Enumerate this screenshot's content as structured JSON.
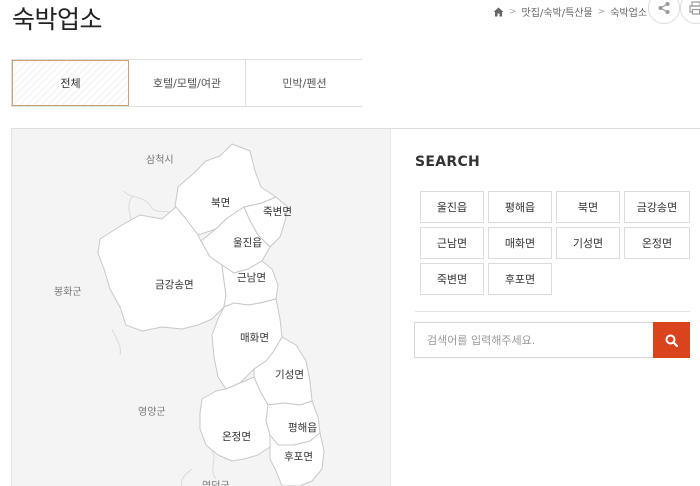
{
  "page": {
    "title": "숙박업소"
  },
  "breadcrumb": {
    "home_icon": "home-icon",
    "items": [
      "맛집/숙박/특산물",
      "숙박업소"
    ]
  },
  "actions": {
    "share_icon": "share-icon",
    "print_icon": "print-icon"
  },
  "tabs": [
    {
      "label": "전체",
      "active": true
    },
    {
      "label": "호텔/모텔/여관",
      "active": false
    },
    {
      "label": "민박/펜션",
      "active": false
    }
  ],
  "map": {
    "regions": [
      "북면",
      "죽변면",
      "울진읍",
      "금강송면",
      "근남면",
      "매화면",
      "기성면",
      "온정면",
      "평해읍",
      "후포면"
    ],
    "neighbors": [
      "삼척시",
      "봉화군",
      "영양군",
      "영덕군"
    ]
  },
  "search": {
    "heading": "SEARCH",
    "regions": [
      "울진읍",
      "평해읍",
      "북면",
      "금강송면",
      "근남면",
      "매화면",
      "기성면",
      "온정면",
      "죽변면",
      "후포면"
    ],
    "placeholder": "검색어를 입력해주세요.",
    "button_icon": "search-icon",
    "accent_color": "#d9441c"
  }
}
